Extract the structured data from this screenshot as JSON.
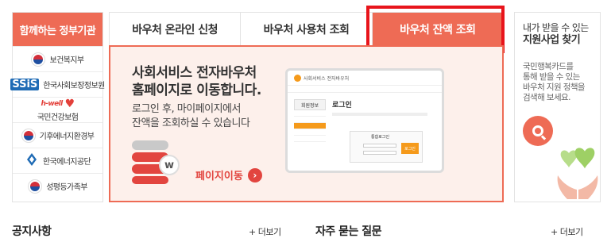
{
  "sidebar": {
    "title": "함께하는 정부기관",
    "orgs": [
      {
        "name": "보건복지부",
        "logo": "emblem-icon"
      },
      {
        "name": "한국사회보장정보원",
        "logo_text": "SSiS"
      },
      {
        "name": "국민건강보험",
        "logo_text": "h-well"
      },
      {
        "name": "기후에너지환경부",
        "logo": "emblem-icon"
      },
      {
        "name": "한국에너지공단",
        "logo": "energy-icon"
      },
      {
        "name": "성평등가족부",
        "logo": "emblem-icon"
      }
    ]
  },
  "tabs": [
    {
      "label": "바우처 온라인 신청",
      "active": false
    },
    {
      "label": "바우처 사용처 조회",
      "active": false
    },
    {
      "label": "바우처 잔액 조회",
      "active": true
    }
  ],
  "panel": {
    "title_line1": "사회서비스 전자바우처",
    "title_line2": "홈페이지로 이동합니다.",
    "desc_line1": "로그인 후, 마이페이지에서",
    "desc_line2": "잔액을 조회하실 수 있습니다",
    "link_label": "페이지이동",
    "mock": {
      "site_name": "사회서비스 전자바우처",
      "side_title": "회원정보",
      "main_title": "로그인",
      "login_title": "통합로그인",
      "login_button": "로그인"
    }
  },
  "promo": {
    "title_line1": "내가 받을 수 있는",
    "title_line2": "지원사업 찾기",
    "desc_lines": [
      "국민행복카드를",
      "통해 받을 수 있는",
      "바우처 지원 정책을",
      "검색해 보세요."
    ]
  },
  "bottom": {
    "notice_title": "공지사항",
    "notice_more": "+ 더보기",
    "faq_title": "자주 묻는 질문",
    "faq_more": "+ 더보기"
  },
  "colors": {
    "accent": "#ee6b55",
    "highlight": "#e8141b",
    "panel_bg": "#fdf0eb"
  }
}
